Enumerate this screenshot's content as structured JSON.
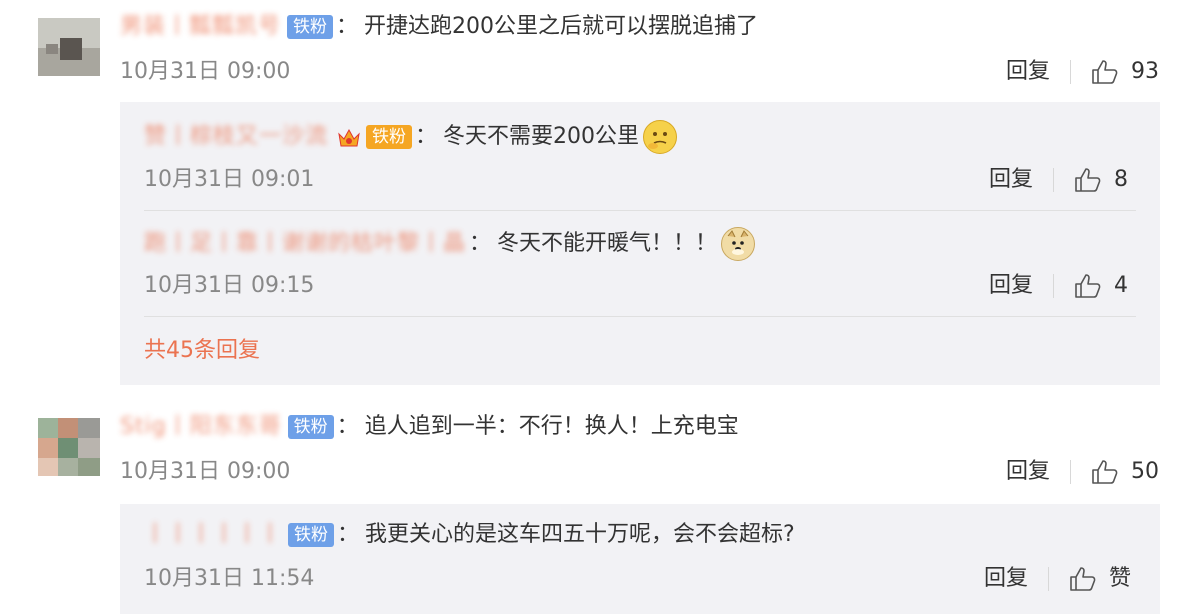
{
  "comments": [
    {
      "username": "男装丨瓢瓢凯号",
      "badge": "铁粉",
      "text": "开捷达跑200公里之后就可以摆脱追捕了",
      "time": "10月31日 09:00",
      "reply_label": "回复",
      "likes": "93",
      "replies": [
        {
          "username": "赞丨棕枝又一沙流",
          "badge": "铁粉",
          "text": "冬天不需要200公里",
          "emoji": "thinking-emoji",
          "time": "10月31日 09:01",
          "reply_label": "回复",
          "likes": "8"
        },
        {
          "username": "跑丨足丨靠丨谢谢的枯叶黎丨晶",
          "badge": "",
          "text": "冬天不能开暖气！！！",
          "emoji": "doge-emoji",
          "time": "10月31日 09:15",
          "reply_label": "回复",
          "likes": "4"
        }
      ],
      "more_label": "共45条回复"
    },
    {
      "username": "Stig丨阳东东哥",
      "badge": "铁粉",
      "text": "追人追到一半：不行！换人！上充电宝",
      "time": "10月31日 09:00",
      "reply_label": "回复",
      "likes": "50",
      "replies": [
        {
          "username": "丨丨丨丨丨丨",
          "badge": "铁粉",
          "text": "我更关心的是这车四五十万呢，会不会超标?",
          "time": "10月31日 11:54",
          "reply_label": "回复",
          "likes": "赞"
        }
      ]
    }
  ],
  "colors": {
    "accent": "#eb7350",
    "badge": "#6ea0e8",
    "sub_bg": "#f2f2f5"
  }
}
